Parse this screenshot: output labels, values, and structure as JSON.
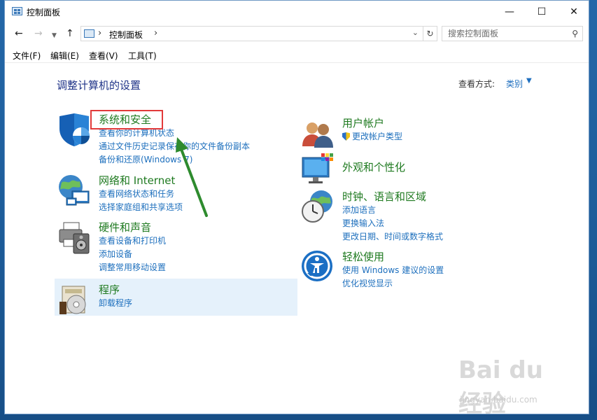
{
  "window": {
    "title": "控制面板"
  },
  "address": {
    "crumb": "控制面板"
  },
  "search": {
    "placeholder": "搜索控制面板"
  },
  "menu": [
    "文件(F)",
    "编辑(E)",
    "查看(V)",
    "工具(T)"
  ],
  "main": {
    "title": "调整计算机的设置",
    "view_by_label": "查看方式:",
    "view_by_value": "类别"
  },
  "categories": [
    {
      "heading": "系统和安全",
      "links": [
        "查看你的计算机状态",
        "通过文件历史记录保存你的文件备份副本",
        "备份和还原(Windows 7)"
      ],
      "icon": "shield-icon"
    },
    {
      "heading": "网络和 Internet",
      "links": [
        "查看网络状态和任务",
        "选择家庭组和共享选项"
      ],
      "icon": "network-globe-icon"
    },
    {
      "heading": "硬件和声音",
      "links": [
        "查看设备和打印机",
        "添加设备",
        "调整常用移动设置"
      ],
      "icon": "printer-icon"
    },
    {
      "heading": "程序",
      "links": [
        "卸载程序"
      ],
      "icon": "programs-disc-icon"
    },
    {
      "heading": "用户帐户",
      "links": [
        "更改帐户类型"
      ],
      "icon": "users-icon"
    },
    {
      "heading": "外观和个性化",
      "links": [],
      "icon": "monitor-palette-icon"
    },
    {
      "heading": "时钟、语言和区域",
      "links": [
        "添加语言",
        "更换输入法",
        "更改日期、时间或数字格式"
      ],
      "icon": "clock-globe-icon"
    },
    {
      "heading": "轻松使用",
      "links": [
        "使用 Windows 建议的设置",
        "优化视觉显示"
      ],
      "icon": "ease-of-access-icon"
    }
  ],
  "watermark": {
    "brand": "Bai du 经验",
    "url": "jingyan.baidu.com"
  },
  "colors": {
    "heading_green": "#1f7a20",
    "link_blue": "#1d6fbd",
    "title_blue": "#1e3287",
    "annotation_red": "#e23a3a",
    "arrow_green": "#2e8b2e"
  }
}
